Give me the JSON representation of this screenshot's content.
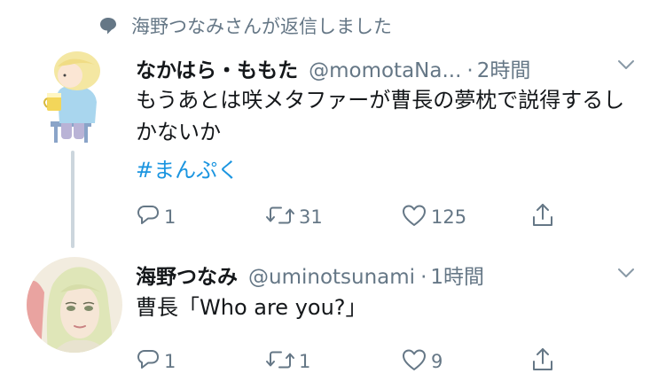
{
  "retweet": {
    "text": "海野つなみさんが返信しました"
  },
  "tweets": [
    {
      "name": "なかはら・ももた",
      "handle": "@momotaNa...",
      "dot": "·",
      "time": "2時間",
      "text": "もうあとは咲メタファーが曹長の夢枕で説得するしかないか",
      "hashtag": "#まんぷく",
      "replies": "1",
      "retweets": "31",
      "likes": "125"
    },
    {
      "name": "海野つなみ",
      "handle": "@uminotsunami",
      "dot": "·",
      "time": "1時間",
      "text": "曹長「Who are you?」",
      "replies": "1",
      "retweets": "1",
      "likes": "9"
    }
  ],
  "icons": {
    "retweet_bar": "speech-bubble-icon",
    "reply": "reply-icon",
    "retweet": "retweet-icon",
    "like": "heart-icon",
    "share": "share-icon",
    "menu": "chevron-down-icon"
  },
  "colors": {
    "text": "#14171a",
    "secondary": "#657786",
    "link": "#1b95e0",
    "thread_line": "#ccd6dd"
  }
}
